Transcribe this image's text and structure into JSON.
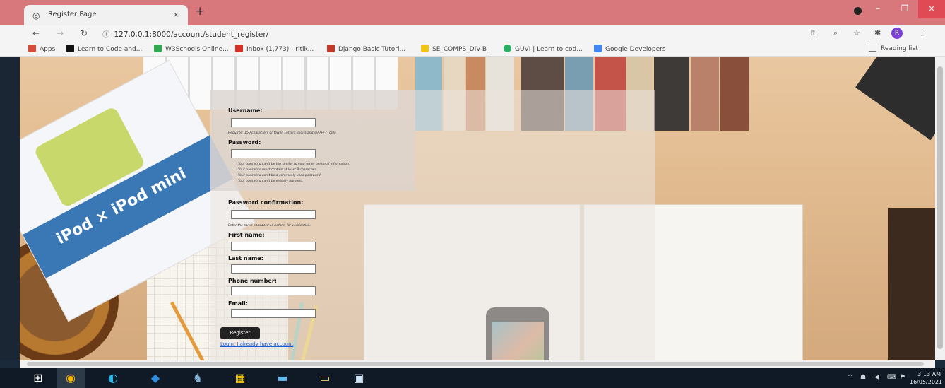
{
  "browser": {
    "tab_title": "Register Page",
    "tab_close": "×",
    "new_tab": "+",
    "url": "127.0.0.1:8000/account/student_register/",
    "profile_initial": "R",
    "window_buttons": [
      "–",
      "❐",
      "×"
    ]
  },
  "bookmarks": [
    {
      "label": "Apps",
      "color": "#d94a3a"
    },
    {
      "label": "Learn to Code and...",
      "color": "#111111"
    },
    {
      "label": "W3Schools Online...",
      "color": "#2fa84f"
    },
    {
      "label": "Inbox (1,773) - ritik...",
      "color": "#d93025"
    },
    {
      "label": "Django Basic Tutori...",
      "color": "#c0392b"
    },
    {
      "label": "SE_COMPS_DIV-B_",
      "color": "#f1c40f"
    },
    {
      "label": "GUVI | Learn to cod...",
      "color": "#27ae60"
    },
    {
      "label": "Google Developers",
      "color": "#4285f4"
    }
  ],
  "reading_list": "Reading list",
  "form": {
    "username_label": "Username:",
    "username_help": "Required. 150 characters or fewer. Letters, digits and @/./+/-/_ only.",
    "password_label": "Password:",
    "password_help": [
      "Your password can’t be too similar to your other personal information.",
      "Your password must contain at least 8 characters.",
      "Your password can’t be a commonly used password.",
      "Your password can’t be entirely numeric."
    ],
    "password_confirm_label": "Password confirmation:",
    "password_confirm_help": "Enter the same password as before, for verification.",
    "first_name_label": "First name:",
    "last_name_label": "Last name:",
    "phone_label": "Phone number:",
    "email_label": "Email:",
    "register_button": "Register",
    "login_link": "Login, I already have account"
  },
  "taskbar": {
    "time": "3:13 AM",
    "date": "16/05/2021"
  }
}
